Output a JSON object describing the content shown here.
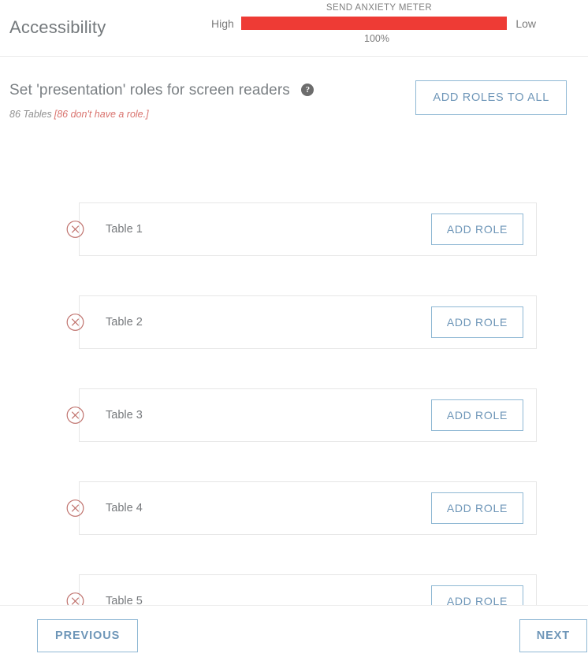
{
  "header": {
    "app_title": "Accessibility",
    "meter": {
      "caption": "SEND ANXIETY METER",
      "left_label": "High",
      "right_label": "Low",
      "percent_label": "100%",
      "percent_value": 100,
      "fill_color": "#ee3b35",
      "track_color": "#f2f2f2"
    }
  },
  "section": {
    "title": "Set 'presentation' roles for screen readers",
    "help_icon": "help-circle-icon",
    "help_glyph": "?",
    "subtitle_count": "86 Tables",
    "subtitle_warning": "[86 don't have a role.]",
    "add_all_label": "ADD ROLES TO ALL",
    "warning_color": "#d9736e"
  },
  "rows": [
    {
      "label": "Table 1",
      "status_icon": "circle-x-icon",
      "action_label": "ADD ROLE"
    },
    {
      "label": "Table 2",
      "status_icon": "circle-x-icon",
      "action_label": "ADD ROLE"
    },
    {
      "label": "Table 3",
      "status_icon": "circle-x-icon",
      "action_label": "ADD ROLE"
    },
    {
      "label": "Table 4",
      "status_icon": "circle-x-icon",
      "action_label": "ADD ROLE"
    },
    {
      "label": "Table 5",
      "status_icon": "circle-x-icon",
      "action_label": "ADD ROLE"
    }
  ],
  "footer": {
    "previous_label": "PREVIOUS",
    "next_label": "NEXT"
  },
  "colors": {
    "accent_blue": "#6e96b8",
    "border_blue": "#8fb8d4",
    "status_red": "#c0736e",
    "text_gray": "#76797c"
  }
}
